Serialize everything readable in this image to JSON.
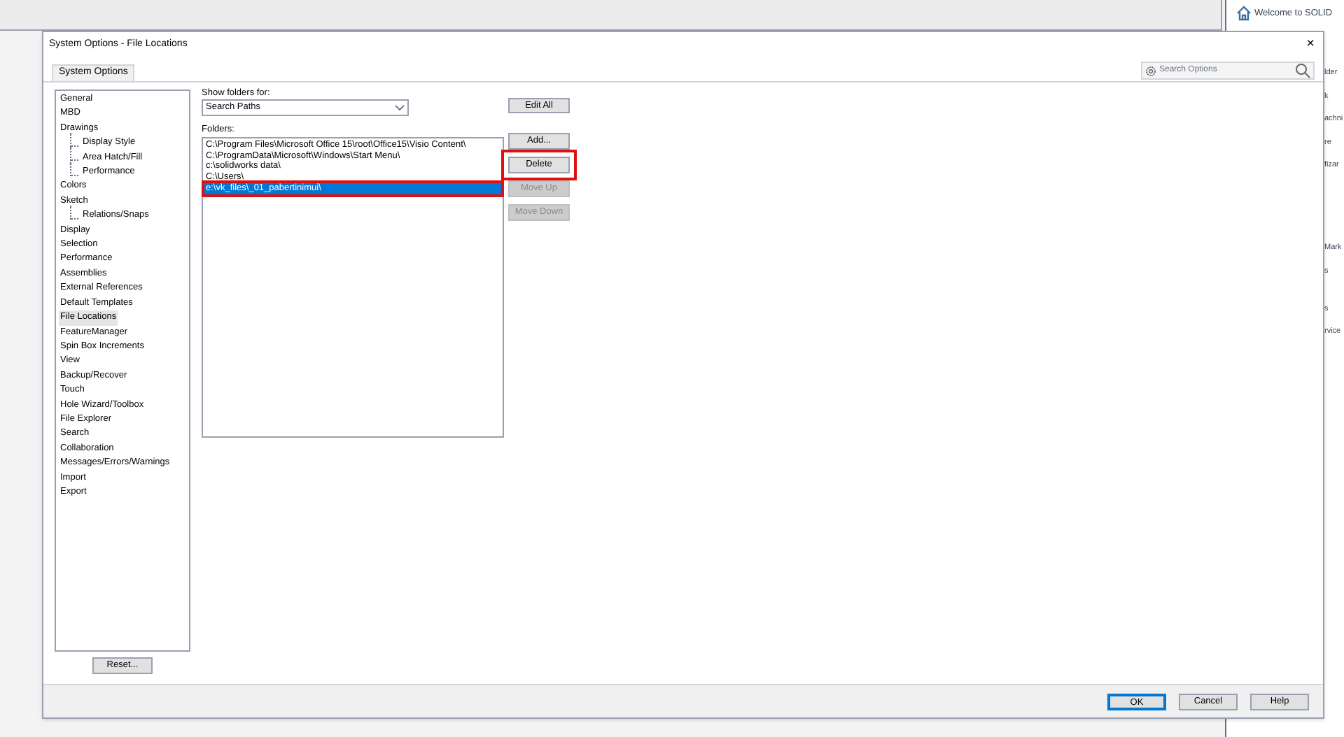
{
  "background_window": {
    "title": "Welcome to SOLID",
    "fragments": [
      "lder",
      "k",
      "achni",
      "re",
      "fizar",
      "Mark",
      "s",
      "s",
      "rvice"
    ]
  },
  "window": {
    "title": "System Options - File Locations",
    "close": "×"
  },
  "tabs": [
    {
      "label": "System Options",
      "selected": true
    }
  ],
  "search": {
    "placeholder": "Search Options"
  },
  "sidebar": {
    "items": [
      {
        "label": "General",
        "selected": false
      },
      {
        "label": "MBD",
        "selected": false
      },
      {
        "label": "Drawings",
        "selected": false,
        "children": [
          {
            "label": "Display Style",
            "selected": false
          },
          {
            "label": "Area Hatch/Fill",
            "selected": false
          },
          {
            "label": "Performance",
            "selected": false
          }
        ]
      },
      {
        "label": "Colors",
        "selected": false
      },
      {
        "label": "Sketch",
        "selected": false,
        "children": [
          {
            "label": "Relations/Snaps",
            "selected": false
          }
        ]
      },
      {
        "label": "Display",
        "selected": false
      },
      {
        "label": "Selection",
        "selected": false
      },
      {
        "label": "Performance",
        "selected": false
      },
      {
        "label": "Assemblies",
        "selected": false
      },
      {
        "label": "External References",
        "selected": false
      },
      {
        "label": "Default Templates",
        "selected": false
      },
      {
        "label": "File Locations",
        "selected": true
      },
      {
        "label": "FeatureManager",
        "selected": false
      },
      {
        "label": "Spin Box Increments",
        "selected": false
      },
      {
        "label": "View",
        "selected": false
      },
      {
        "label": "Backup/Recover",
        "selected": false
      },
      {
        "label": "Touch",
        "selected": false
      },
      {
        "label": "Hole Wizard/Toolbox",
        "selected": false
      },
      {
        "label": "File Explorer",
        "selected": false
      },
      {
        "label": "Search",
        "selected": false
      },
      {
        "label": "Collaboration",
        "selected": false
      },
      {
        "label": "Messages/Errors/Warnings",
        "selected": false
      },
      {
        "label": "Import",
        "selected": false
      },
      {
        "label": "Export",
        "selected": false
      }
    ]
  },
  "reset_button": "Reset...",
  "show_folders": {
    "label": "Show folders for:",
    "value": "Search Paths"
  },
  "edit_all_button": "Edit All",
  "folders": {
    "label": "Folders:",
    "items": [
      {
        "path": "C:\\Program Files\\Microsoft Office 15\\root\\Office15\\Visio Content\\",
        "selected": false
      },
      {
        "path": "C:\\ProgramData\\Microsoft\\Windows\\Start Menu\\",
        "selected": false
      },
      {
        "path": "c:\\solidworks data\\",
        "selected": false
      },
      {
        "path": "C:\\Users\\",
        "selected": false
      },
      {
        "path": "e:\\vk_files\\_01_pabertinimui\\",
        "selected": true
      }
    ]
  },
  "side_buttons": [
    {
      "label": "Add...",
      "disabled": false,
      "highlighted": false
    },
    {
      "label": "Delete",
      "disabled": false,
      "highlighted": true
    },
    {
      "label": "Move Up",
      "disabled": true,
      "highlighted": false
    },
    {
      "label": "Move Down",
      "disabled": true,
      "highlighted": false
    }
  ],
  "footer_buttons": [
    {
      "label": "OK",
      "default": true
    },
    {
      "label": "Cancel",
      "default": false
    },
    {
      "label": "Help",
      "default": false
    }
  ]
}
